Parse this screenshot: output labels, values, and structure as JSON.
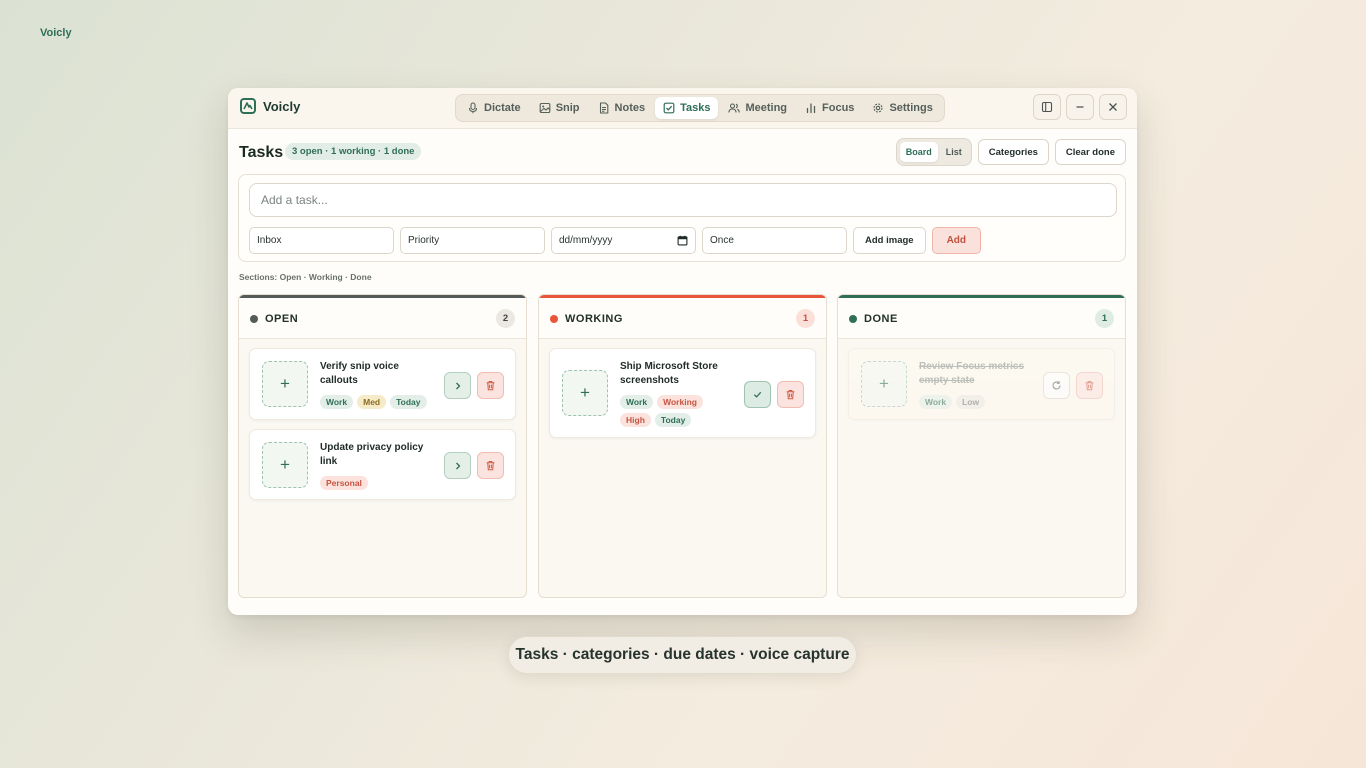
{
  "corner_brand": "Voicly",
  "app": {
    "name": "Voicly"
  },
  "nav": [
    {
      "label": "Dictate",
      "icon": "microphone-icon"
    },
    {
      "label": "Snip",
      "icon": "image-icon"
    },
    {
      "label": "Notes",
      "icon": "document-icon"
    },
    {
      "label": "Tasks",
      "icon": "checkbox-icon",
      "active": true
    },
    {
      "label": "Meeting",
      "icon": "users-icon"
    },
    {
      "label": "Focus",
      "icon": "bar-chart-icon"
    },
    {
      "label": "Settings",
      "icon": "gear-icon"
    }
  ],
  "page": {
    "title": "Tasks",
    "summary": "3 open · 1 working · 1 done",
    "view_toggle": {
      "board": "Board",
      "list": "List",
      "active": "Board"
    },
    "categories_label": "Categories",
    "clear_done_label": "Clear done"
  },
  "composer": {
    "placeholder": "Add a task...",
    "category": "Inbox",
    "priority_placeholder": "Priority",
    "date_placeholder": "dd/mm/yyyy",
    "repeat": "Once",
    "add_image_label": "Add image",
    "add_label": "Add"
  },
  "sections_note": "Sections: Open · Working · Done",
  "columns": [
    {
      "title": "OPEN",
      "count": "2",
      "color": "#555b58",
      "cards": [
        {
          "title": "Verify snip voice callouts",
          "tags": [
            {
              "label": "Work",
              "tone": "green"
            },
            {
              "label": "Med",
              "tone": "yellow"
            },
            {
              "label": "Today",
              "tone": "green"
            }
          ]
        },
        {
          "title": "Update privacy policy link",
          "tags": [
            {
              "label": "Personal",
              "tone": "red"
            }
          ]
        }
      ]
    },
    {
      "title": "WORKING",
      "count": "1",
      "color": "#e8553a",
      "cards": [
        {
          "title": "Ship Microsoft Store screenshots",
          "tags": [
            {
              "label": "Work",
              "tone": "green"
            },
            {
              "label": "Working",
              "tone": "red"
            },
            {
              "label": "High",
              "tone": "red"
            },
            {
              "label": "Today",
              "tone": "green"
            }
          ]
        }
      ]
    },
    {
      "title": "DONE",
      "count": "1",
      "color": "#2f6f57",
      "cards": [
        {
          "title": "Review Focus metrics empty state",
          "tags": [
            {
              "label": "Work",
              "tone": "green"
            },
            {
              "label": "Low",
              "tone": "gray"
            }
          ]
        }
      ]
    }
  ],
  "caption": "Tasks · categories · due dates · voice capture"
}
